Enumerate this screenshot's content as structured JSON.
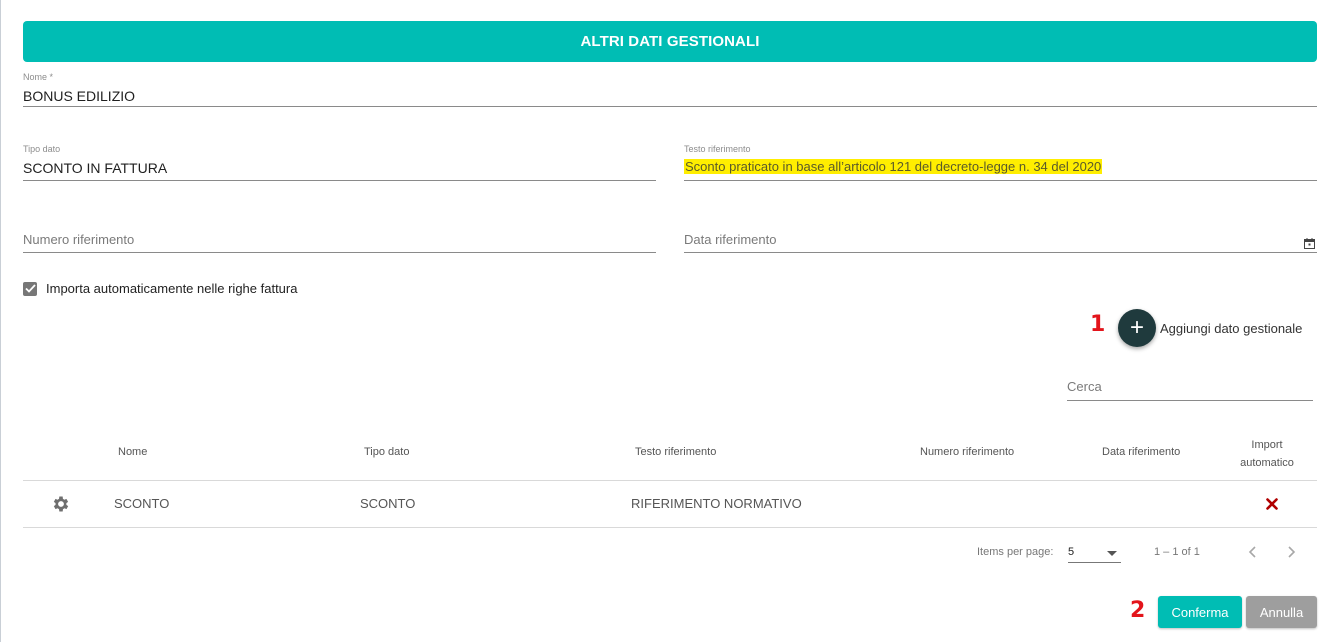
{
  "dialog": {
    "title": "ALTRI DATI GESTIONALI"
  },
  "form": {
    "nome": {
      "label": "Nome *",
      "value": "BONUS EDILIZIO"
    },
    "tipo_dato": {
      "label": "Tipo dato",
      "value": "SCONTO IN FATTURA"
    },
    "testo_riferimento": {
      "label": "Testo riferimento",
      "value": "Sconto praticato in base all’articolo 121 del decreto-legge n. 34 del 2020"
    },
    "numero_riferimento": {
      "placeholder": "Numero riferimento"
    },
    "data_riferimento": {
      "placeholder": "Data riferimento"
    },
    "import_auto": {
      "label": "Importa automaticamente nelle righe fattura",
      "checked": true
    }
  },
  "markers": {
    "first": "1",
    "second": "2"
  },
  "add_button": {
    "label": "Aggiungi dato gestionale",
    "icon": "plus-icon"
  },
  "search": {
    "placeholder": "Cerca"
  },
  "table": {
    "headers": {
      "nome": "Nome",
      "tipo_dato": "Tipo dato",
      "testo": "Testo riferimento",
      "numero": "Numero riferimento",
      "data": "Data riferimento",
      "import_line1": "Import",
      "import_line2": "automatico"
    },
    "rows": [
      {
        "nome": "SCONTO",
        "tipo_dato": "SCONTO",
        "testo": "RIFERIMENTO NORMATIVO",
        "numero": "",
        "data": "",
        "import_automatico": false
      }
    ]
  },
  "paginator": {
    "items_label": "Items per page:",
    "page_size": "5",
    "range": "1 – 1 of 1"
  },
  "actions": {
    "confirm": "Conferma",
    "cancel": "Annulla"
  },
  "colors": {
    "accent": "#00bdb4",
    "fab": "#1f3a3d",
    "highlight": "#ffee00",
    "marker": "#e3141b",
    "delete": "#b00000"
  }
}
